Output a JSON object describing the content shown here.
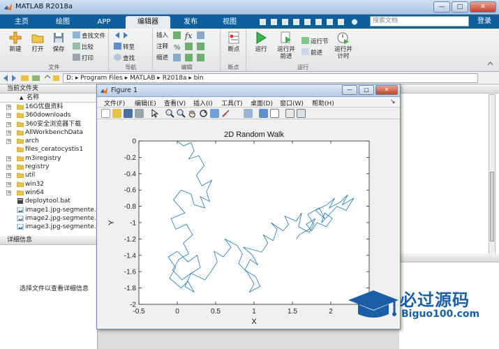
{
  "window": {
    "title": "MATLAB R2018a",
    "btn_min": "—",
    "btn_max": "□",
    "btn_close": "✕"
  },
  "tabs": [
    {
      "label": "主页",
      "active": false
    },
    {
      "label": "绘图",
      "active": false
    },
    {
      "label": "APP",
      "active": false
    },
    {
      "label": "编辑器",
      "active": true
    },
    {
      "label": "发布",
      "active": false
    },
    {
      "label": "视图",
      "active": false
    }
  ],
  "search": {
    "placeholder": "搜索文档"
  },
  "login_label": "登录",
  "ribbon": {
    "file_group": {
      "label": "文件",
      "new": "新建",
      "open": "打开",
      "save": "保存",
      "find_files": "查找文件",
      "compare": "比较",
      "print": "打印"
    },
    "nav_group": {
      "label": "导航",
      "goto": "转至",
      "find": "查找"
    },
    "edit_group": {
      "label": "编辑",
      "insert": "插入",
      "comment": "注释",
      "indent": "缩进"
    },
    "breakpoint_group": {
      "label": "断点",
      "breakpoints": "断点"
    },
    "run_group": {
      "label": "运行",
      "run": "运行",
      "run_advance_1": "运行并",
      "run_advance_2": "前进",
      "run_section": "运行节",
      "advance": "前进",
      "run_time_1": "运行并",
      "run_time_2": "计时"
    }
  },
  "address": {
    "segments": [
      "D:",
      "Program Files",
      "MATLAB",
      "R2018a",
      "bin"
    ],
    "separator": "▸"
  },
  "current_folder": {
    "header": "当前文件夹",
    "column_name": "名称",
    "column_sort": "▲",
    "items": [
      {
        "name": "16G优盘资料",
        "type": "folder",
        "expandable": true
      },
      {
        "name": "360downloads",
        "type": "folder",
        "expandable": true
      },
      {
        "name": "360安全浏览器下载",
        "type": "folder",
        "expandable": true
      },
      {
        "name": "AllWorkbenchData",
        "type": "folder",
        "expandable": true
      },
      {
        "name": "arch",
        "type": "folder",
        "expandable": true
      },
      {
        "name": "files_ceratocystis1",
        "type": "folder",
        "expandable": false
      },
      {
        "name": "m3iregistry",
        "type": "folder",
        "expandable": true
      },
      {
        "name": "registry",
        "type": "folder",
        "expandable": true
      },
      {
        "name": "util",
        "type": "folder",
        "expandable": true
      },
      {
        "name": "win32",
        "type": "folder",
        "expandable": true
      },
      {
        "name": "win64",
        "type": "folder",
        "expandable": true
      },
      {
        "name": "deploytool.bat",
        "type": "bat",
        "expandable": false
      },
      {
        "name": "image1.jpg-segmente...",
        "type": "image",
        "expandable": false
      },
      {
        "name": "image2.jpg-segmente...",
        "type": "image",
        "expandable": false
      },
      {
        "name": "image3.jpg-segmente...",
        "type": "image",
        "expandable": false
      }
    ]
  },
  "details": {
    "header": "详细信息",
    "hint": "选择文件以查看详细信息"
  },
  "figure": {
    "title": "Figure 1",
    "btn_min": "—",
    "btn_max": "□",
    "btn_close": "✕",
    "menus": [
      "文件(F)",
      "编辑(E)",
      "查看(V)",
      "插入(I)",
      "工具(T)",
      "桌面(D)",
      "窗口(W)",
      "帮助(H)"
    ],
    "menu_arrow": "↘"
  },
  "watermark": {
    "brand": "必过源码",
    "url": "Biguo100.com"
  },
  "chart_data": {
    "type": "line",
    "title": "2D Random Walk",
    "xlabel": "X",
    "ylabel": "Y",
    "xlim": [
      -0.5,
      2.5
    ],
    "ylim": [
      -2,
      0
    ],
    "xticks": [
      -0.5,
      0,
      0.5,
      1,
      1.5,
      2
    ],
    "yticks": [
      0,
      -0.2,
      -0.4,
      -0.6,
      -0.8,
      -1,
      -1.2,
      -1.4,
      -1.6,
      -1.8,
      -2
    ],
    "line_color": "#1f77b4",
    "grid": false,
    "series": [
      {
        "x": [
          0,
          0.08,
          0.18,
          0.22,
          0.15,
          0.28,
          0.35,
          0.25,
          0.32,
          0.45,
          0.38,
          0.42,
          0.3,
          0.36,
          0.22,
          0.18,
          0.05,
          -0.05,
          0.1,
          -0.08,
          -0.02,
          0.12,
          0.2,
          0.08,
          0.15,
          0.02,
          -0.06,
          0.06,
          0.18,
          0.1,
          0.22,
          0.14,
          0.05,
          -0.1,
          -0.02,
          -0.12,
          0.0,
          0.14,
          0.26,
          0.3,
          0.18,
          0.36,
          0.44,
          0.52,
          0.48,
          0.6,
          0.7,
          0.62,
          0.78,
          0.85,
          0.8,
          0.92,
          1.0,
          0.94,
          1.08,
          1.02,
          0.88,
          0.95,
          1.05,
          0.98,
          0.86,
          1.1,
          1.18,
          1.12,
          1.25,
          1.3,
          1.22,
          1.38,
          1.45,
          1.4,
          1.55,
          1.62,
          1.58,
          1.72,
          1.78,
          1.7,
          1.85,
          1.92,
          1.8,
          1.95,
          2.05,
          1.98,
          2.12,
          2.22,
          2.15,
          2.3,
          2.2,
          2.08,
          1.96,
          1.88,
          1.92,
          2.02,
          1.94,
          1.82,
          1.75,
          1.68,
          1.8,
          1.72,
          1.6,
          1.55
        ],
        "y": [
          0,
          -0.06,
          -0.02,
          -0.12,
          -0.22,
          -0.18,
          -0.3,
          -0.42,
          -0.55,
          -0.48,
          -0.62,
          -0.74,
          -0.68,
          -0.82,
          -0.78,
          -0.65,
          -0.6,
          -0.72,
          -0.88,
          -0.95,
          -1.08,
          -1.02,
          -1.15,
          -1.25,
          -1.38,
          -1.45,
          -1.58,
          -1.7,
          -1.62,
          -1.78,
          -1.85,
          -1.72,
          -1.8,
          -1.68,
          -1.55,
          -1.42,
          -1.35,
          -1.48,
          -1.4,
          -1.55,
          -1.62,
          -1.7,
          -1.6,
          -1.48,
          -1.35,
          -1.42,
          -1.3,
          -1.2,
          -1.28,
          -1.38,
          -1.5,
          -1.62,
          -1.75,
          -1.85,
          -1.78,
          -1.66,
          -1.58,
          -1.45,
          -1.52,
          -1.4,
          -1.3,
          -1.36,
          -1.25,
          -1.15,
          -1.22,
          -1.08,
          -1.0,
          -1.1,
          -1.02,
          -0.92,
          -0.98,
          -0.88,
          -1.05,
          -1.12,
          -1.02,
          -0.9,
          -0.82,
          -0.95,
          -0.85,
          -0.78,
          -0.7,
          -0.82,
          -0.75,
          -0.66,
          -0.78,
          -0.7,
          -0.85,
          -0.8,
          -0.92,
          -1.0,
          -0.88,
          -0.95,
          -1.05,
          -1.0,
          -1.1,
          -1.02,
          -0.95,
          -1.08,
          -1.14,
          -1.2
        ]
      }
    ]
  }
}
